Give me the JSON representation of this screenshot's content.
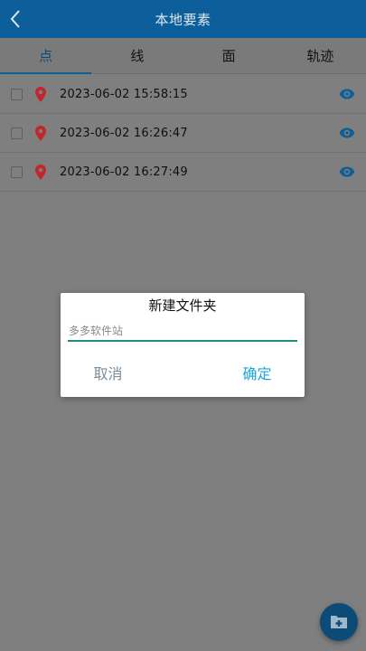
{
  "header": {
    "title": "本地要素",
    "back_icon": "chevron-left-icon"
  },
  "tabs": [
    {
      "label": "点",
      "active": true
    },
    {
      "label": "线",
      "active": false
    },
    {
      "label": "面",
      "active": false
    },
    {
      "label": "轨迹",
      "active": false
    }
  ],
  "items": [
    {
      "time": "2023-06-02 15:58:15",
      "checked": false,
      "icon": "map-pin-icon",
      "action_icon": "eye-icon"
    },
    {
      "time": "2023-06-02 16:26:47",
      "checked": false,
      "icon": "map-pin-icon",
      "action_icon": "eye-icon"
    },
    {
      "time": "2023-06-02 16:27:49",
      "checked": false,
      "icon": "map-pin-icon",
      "action_icon": "eye-icon"
    }
  ],
  "dialog": {
    "title": "新建文件夹",
    "input_value": "多多软件站",
    "cancel_label": "取消",
    "confirm_label": "确定"
  },
  "fab": {
    "icon": "add-folder-icon"
  },
  "colors": {
    "header_bg": "#0d5f9c",
    "accent": "#19a6d6",
    "input_underline": "#1a8f7c",
    "pin": "#c0272d",
    "overlay": "#7f7f7f"
  }
}
